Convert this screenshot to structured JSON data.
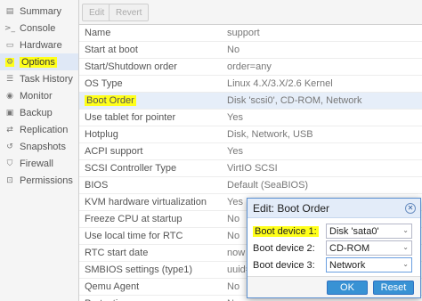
{
  "sidebar": {
    "items": [
      {
        "label": "Summary",
        "icon": "summary-icon"
      },
      {
        "label": "Console",
        "icon": "terminal-icon"
      },
      {
        "label": "Hardware",
        "icon": "monitor-icon"
      },
      {
        "label": "Options",
        "icon": "gear-icon"
      },
      {
        "label": "Task History",
        "icon": "list-icon"
      },
      {
        "label": "Monitor",
        "icon": "eye-icon"
      },
      {
        "label": "Backup",
        "icon": "floppy-icon"
      },
      {
        "label": "Replication",
        "icon": "retweet-icon"
      },
      {
        "label": "Snapshots",
        "icon": "history-icon"
      },
      {
        "label": "Firewall",
        "icon": "shield-icon"
      },
      {
        "label": "Permissions",
        "icon": "unlock-icon"
      }
    ]
  },
  "toolbar": {
    "edit_label": "Edit",
    "revert_label": "Revert"
  },
  "options": [
    {
      "key": "Name",
      "value": "support"
    },
    {
      "key": "Start at boot",
      "value": "No"
    },
    {
      "key": "Start/Shutdown order",
      "value": "order=any"
    },
    {
      "key": "OS Type",
      "value": "Linux 4.X/3.X/2.6 Kernel"
    },
    {
      "key": "Boot Order",
      "value": "Disk 'scsi0', CD-ROM, Network"
    },
    {
      "key": "Use tablet for pointer",
      "value": "Yes"
    },
    {
      "key": "Hotplug",
      "value": "Disk, Network, USB"
    },
    {
      "key": "ACPI support",
      "value": "Yes"
    },
    {
      "key": "SCSI Controller Type",
      "value": "VirtIO SCSI"
    },
    {
      "key": "BIOS",
      "value": "Default (SeaBIOS)"
    },
    {
      "key": "KVM hardware virtualization",
      "value": "Yes"
    },
    {
      "key": "Freeze CPU at startup",
      "value": "No"
    },
    {
      "key": "Use local time for RTC",
      "value": "No"
    },
    {
      "key": "RTC start date",
      "value": "now"
    },
    {
      "key": "SMBIOS settings (type1)",
      "value": "uuid="
    },
    {
      "key": "Qemu Agent",
      "value": "No"
    },
    {
      "key": "Protection",
      "value": "No"
    }
  ],
  "dialog": {
    "title": "Edit: Boot Order",
    "fields": [
      {
        "label": "Boot device 1:",
        "value": "Disk 'sata0'"
      },
      {
        "label": "Boot device 2:",
        "value": "CD-ROM"
      },
      {
        "label": "Boot device 3:",
        "value": "Network"
      }
    ],
    "ok_label": "OK",
    "reset_label": "Reset"
  },
  "colors": {
    "highlight": "#ffff1a",
    "accent": "#3892d4",
    "selected_row": "#e6eef9"
  }
}
